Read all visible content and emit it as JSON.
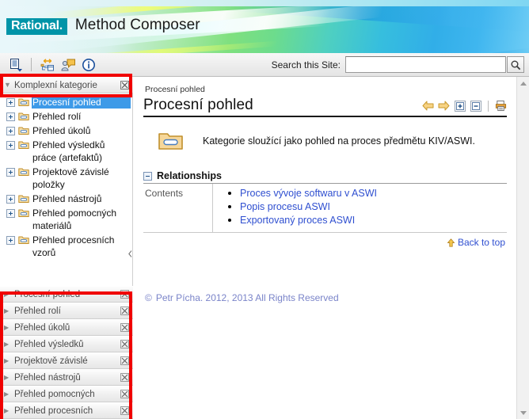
{
  "banner": {
    "logo_text": "Rational.",
    "product_title": "Method Composer",
    "logo_bg": "#0094a8"
  },
  "toolbar": {
    "icons": [
      {
        "name": "page-list-dropdown-icon",
        "title": "Views"
      },
      {
        "name": "expand-collapse-tree-icon",
        "title": "Expand Activity Tree"
      },
      {
        "name": "glossary-icon",
        "title": "Glossary"
      },
      {
        "name": "info-icon",
        "title": "About"
      }
    ],
    "search_label": "Search this Site:",
    "search_value": "",
    "search_placeholder": "",
    "search_button_icon": "search-icon"
  },
  "sidebar": {
    "tree_panel": {
      "title": "Komplexní kategorie",
      "close_icon": "close-icon",
      "expanded": true,
      "items": [
        {
          "label": "Procesní pohled",
          "selected": true
        },
        {
          "label": "Přehled rolí",
          "selected": false
        },
        {
          "label": "Přehled úkolů",
          "selected": false
        },
        {
          "label": "Přehled výsledků práce (artefaktů)",
          "selected": false
        },
        {
          "label": "Projektově závislé položky",
          "selected": false
        },
        {
          "label": "Přehled nástrojů",
          "selected": false
        },
        {
          "label": "Přehled pomocných materiálů",
          "selected": false
        },
        {
          "label": "Přehled procesních vzorů",
          "selected": false
        }
      ]
    },
    "collapsed_panels": [
      {
        "label": "Procesní pohled"
      },
      {
        "label": "Přehled rolí"
      },
      {
        "label": "Přehled úkolů"
      },
      {
        "label": "Přehled výsledků"
      },
      {
        "label": "Projektově závislé"
      },
      {
        "label": "Přehled nástrojů"
      },
      {
        "label": "Přehled pomocných"
      },
      {
        "label": "Přehled procesních"
      }
    ],
    "splitter_collapse_icon": "chevron-left-icon"
  },
  "content": {
    "breadcrumb": "Procesní pohled",
    "title": "Procesní pohled",
    "tools": [
      {
        "name": "back-arrow-icon"
      },
      {
        "name": "forward-arrow-icon"
      },
      {
        "name": "expand-all-icon"
      },
      {
        "name": "collapse-all-icon"
      },
      {
        "name": "print-icon"
      }
    ],
    "description_icon": "folder-icon",
    "description": "Kategorie sloužící jako pohled na proces předmětu KIV/ASWI.",
    "relationships": {
      "title": "Relationships",
      "collapse_icon": "collapse-icon",
      "rows": [
        {
          "key": "Contents",
          "links": [
            "Proces vývoje softwaru v ASWI",
            "Popis procesu ASWI",
            "Exportovaný proces ASWI"
          ]
        }
      ]
    },
    "back_to_top": "Back to top",
    "back_to_top_icon": "up-arrow-icon",
    "copyright_symbol": "©",
    "copyright": "Petr Pícha. 2012, 2013 All Rights Reserved"
  },
  "scrollbar": {
    "up_icon": "scroll-up-icon",
    "down_icon": "scroll-down-icon"
  },
  "annotations": {
    "highlight_color": "#f00000"
  }
}
